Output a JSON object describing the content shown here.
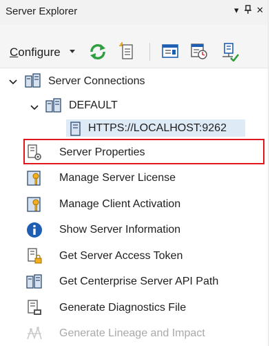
{
  "window": {
    "title": "Server Explorer",
    "dropdown_glyph": "▾",
    "pin_glyph": "⊥",
    "close_glyph": "✕"
  },
  "toolbar": {
    "configure_label_first": "C",
    "configure_label_rest": "onfigure",
    "icons": [
      "refresh-icon",
      "new-document-icon",
      "properties-panel-icon",
      "schedule-icon",
      "server-check-icon"
    ]
  },
  "tree": {
    "root_label": "Server Connections",
    "child_label": "DEFAULT",
    "leaf_label": "HTTPS://LOCALHOST:9262"
  },
  "context_menu": {
    "items": [
      {
        "label": "Server Properties",
        "icon": "server-properties-icon",
        "enabled": true,
        "highlighted": true
      },
      {
        "label": "Manage Server License",
        "icon": "license-key-icon",
        "enabled": true
      },
      {
        "label": "Manage Client Activation",
        "icon": "client-key-icon",
        "enabled": true
      },
      {
        "label": "Show Server Information",
        "icon": "info-icon",
        "enabled": true
      },
      {
        "label": "Get Server Access Token",
        "icon": "access-token-icon",
        "enabled": true
      },
      {
        "label": "Get Centerprise Server API Path",
        "icon": "api-path-icon",
        "enabled": true
      },
      {
        "label": "Generate Diagnostics File",
        "icon": "diagnostics-file-icon",
        "enabled": true
      },
      {
        "label": "Generate Lineage and Impact",
        "icon": "lineage-icon",
        "enabled": false
      }
    ]
  },
  "colors": {
    "accent_green": "#2e9e3e",
    "accent_blue": "#1e5fb4",
    "highlight_border": "#e0161c",
    "selection_bg": "#dfeaf7"
  }
}
